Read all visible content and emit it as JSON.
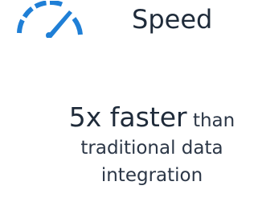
{
  "header": {
    "icon": "speedometer-icon",
    "icon_color": "#1f7fd6",
    "title": "Speed"
  },
  "tagline": {
    "highlight": "5x faster",
    "line1_rest": "than",
    "line2": "traditional data",
    "line3": "integration"
  },
  "colors": {
    "text": "#1f2b3a",
    "accent": "#1f7fd6",
    "background": "#ffffff"
  }
}
